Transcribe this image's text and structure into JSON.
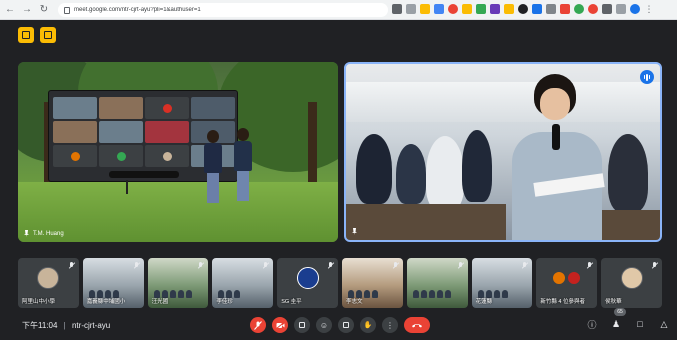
{
  "browser": {
    "url": "meet.google.com/ntr-cjrt-ayu?pli=1&authuser=1"
  },
  "main_tiles": {
    "left": {
      "name": "T.M. Huang"
    }
  },
  "filmstrip": [
    {
      "label": "阿里山中小學",
      "kind": "avatar"
    },
    {
      "label": "嘉義縣中埔國小",
      "kind": "photo"
    },
    {
      "label": "汪光國",
      "kind": "photo"
    },
    {
      "label": "李佳珍",
      "kind": "photo"
    },
    {
      "label": "SG 圭平",
      "kind": "logo"
    },
    {
      "label": "李志文",
      "kind": "photo"
    },
    {
      "label": "",
      "kind": "photo"
    },
    {
      "label": "花蓮縣",
      "kind": "photo"
    },
    {
      "label": "新竹縣 4 位參與者",
      "kind": "pair"
    },
    {
      "label": "侯秋華",
      "kind": "avatar"
    }
  ],
  "bottom_bar": {
    "time": "下午11:04",
    "separator": "|",
    "meeting_code": "ntr-cjrt-ayu",
    "participant_count": "65"
  },
  "colors": {
    "end_call": "#ea4335",
    "active_speaker_border": "#8ab4f8",
    "app_icon": "#fbbc04"
  }
}
